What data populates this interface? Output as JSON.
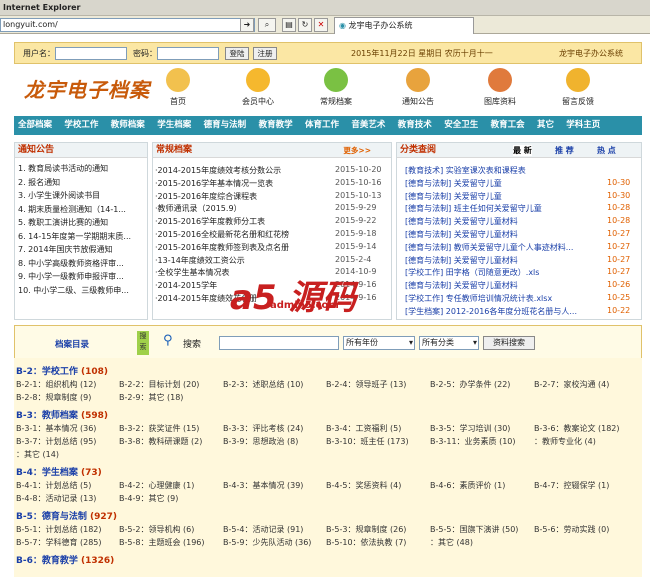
{
  "browser": {
    "title": "Internet Explorer",
    "address": "longyuit.com/",
    "tab": "龙宇电子办公系统"
  },
  "login": {
    "user_label": "用户名：",
    "pass_label": "密码：",
    "login_btn": "登陆",
    "register_btn": "注册",
    "date": "2015年11月22日 星期日 农历十月十一",
    "system": "龙宇电子办公系统"
  },
  "logo": "龙宇电子档案",
  "navicons": [
    {
      "label": "首页",
      "color": "#f2c14e"
    },
    {
      "label": "会员中心",
      "color": "#f5b82e"
    },
    {
      "label": "常规档案",
      "color": "#7ac143"
    },
    {
      "label": "通知公告",
      "color": "#e8a33d"
    },
    {
      "label": "图库资料",
      "color": "#e07a3c"
    },
    {
      "label": "留言反馈",
      "color": "#f0b32e"
    }
  ],
  "mainnav": [
    "全部档案",
    "学校工作",
    "教师档案",
    "学生档案",
    "德育与法制",
    "教育教学",
    "体育工作",
    "音美艺术",
    "教育技术",
    "安全卫生",
    "教育工会",
    "其它",
    "学科主页"
  ],
  "notice": {
    "title": "通知公告",
    "items": [
      "1. 教育局读书活动的通知",
      "2. 报名通知",
      "3. 小学生课外阅读书目",
      "4. 期末质量检测通知（14-1...",
      "5. 教职工演讲比赛的通知",
      "6. 14-15年度第一学期期末质...",
      "7. 2014年国庆节放假通知",
      "8. 中小学高级教师资格评审...",
      "9. 中小学一级教师申报评审...",
      "10. 中小学二级、三级教师申..."
    ]
  },
  "regular": {
    "title": "常规档案",
    "more": "更多>>",
    "items": [
      {
        "t": "·2014-2015年度绩效考核分数公示",
        "d": "2015-10-20"
      },
      {
        "t": "·2015-2016学年基本情况一览表",
        "d": "2015-10-16"
      },
      {
        "t": "·2015-2016年度综合课程表",
        "d": "2015-10-13"
      },
      {
        "t": "·教师通讯录（2015.9）",
        "d": "2015-9-29"
      },
      {
        "t": "·2015-2016学年度教师分工表",
        "d": "2015-9-22"
      },
      {
        "t": "·2015-2016全校最新花名册和红花榜",
        "d": "2015-9-18"
      },
      {
        "t": "·2015-2016年度教师签到表及点名册",
        "d": "2015-9-14"
      },
      {
        "t": "·13-14年度绩效工资公示",
        "d": "2015-2-4"
      },
      {
        "t": "·全校学生基本情况表",
        "d": "2014-10-9"
      },
      {
        "t": "·2014-2015学年",
        "d": "2014-9-16"
      },
      {
        "t": "·2014-2015年度绩效花名册",
        "d": "2014-9-16"
      }
    ]
  },
  "query": {
    "title": "分类查阅",
    "tabs": [
      "最 新",
      "推 荐",
      "热 点"
    ],
    "items": [
      {
        "t": "[教育技术] 实验室课次表和课程表",
        "d": ""
      },
      {
        "t": "[德育与法制] 关爱留守儿童",
        "d": "10-30"
      },
      {
        "t": "[德育与法制] 关爱留守儿童",
        "d": "10-30"
      },
      {
        "t": "[德育与法制] 班主任如何关爱留守儿童",
        "d": "10-28"
      },
      {
        "t": "[德育与法制] 关爱留守儿童材料",
        "d": "10-28"
      },
      {
        "t": "[德育与法制] 关爱留守儿童材料",
        "d": "10-27"
      },
      {
        "t": "[德育与法制] 教师关爱留守儿童个人事迹材料...",
        "d": "10-27"
      },
      {
        "t": "[德育与法制] 关爱留守儿童材料",
        "d": "10-27"
      },
      {
        "t": "[学校工作] 田字格（司随意更改）.xls",
        "d": "10-27"
      },
      {
        "t": "[德育与法制] 关爱留守儿童材料",
        "d": "10-26"
      },
      {
        "t": "[学校工作] 专任教师培训情况统计表.xlsx",
        "d": "10-25"
      },
      {
        "t": "[学生档案] 2012-2016各年度分班花名册与人...",
        "d": "10-22"
      }
    ]
  },
  "archive": {
    "title": "档案目录",
    "side": "搜索",
    "search": "搜索",
    "year": "所有年份",
    "cat": "所有分类",
    "btn": "资料搜索"
  },
  "cats": [
    {
      "h": "B-2：学校工作",
      "c": "(108)",
      "items": [
        "B-2-1：组织机构 (12)",
        "B-2-2：目标计划 (20)",
        "B-2-3：述职总结 (10)",
        "B-2-4：领导班子 (13)",
        "B-2-5：办学条件 (22)",
        "B-2-7：家校沟通 (4)",
        "B-2-8：规章制度 (9)",
        "B-2-9：其它 (18)"
      ]
    },
    {
      "h": "B-3：教师档案",
      "c": "(598)",
      "items": [
        "B-3-1：基本情况 (36)",
        "B-3-2：获奖证件 (15)",
        "B-3-3：评比考核 (24)",
        "B-3-4：工资福利 (5)",
        "B-3-5：学习培训 (30)",
        "B-3-6：教案论文 (182)",
        "B-3-7：计划总结 (95)",
        "B-3-8：教科研课题 (2)",
        "B-3-9：思想政治 (8)",
        "B-3-10：班主任 (173)",
        "B-3-11：业务素质 (10)",
        "：教师专业化 (4)",
        "：其它 (14)"
      ]
    },
    {
      "h": "B-4：学生档案",
      "c": "(73)",
      "items": [
        "B-4-1：计划总结 (5)",
        "B-4-2：心理健康 (1)",
        "B-4-3：基本情况 (39)",
        "B-4-5：奖惩资料 (4)",
        "B-4-6：素质评价 (1)",
        "B-4-7：控辍保学 (1)",
        "B-4-8：活动记录 (13)",
        "B-4-9：其它 (9)"
      ]
    },
    {
      "h": "B-5：德育与法制",
      "c": "(927)",
      "items": [
        "B-5-1：计划总结 (182)",
        "B-5-2：领导机构 (6)",
        "B-5-4：活动记录 (91)",
        "B-5-3：规章制度 (26)",
        "B-5-5：国旗下演讲 (50)",
        "B-5-6：劳动实践 (0)",
        "B-5-7：学科德育 (285)",
        "B-5-8：主题班会 (196)",
        "B-5-9：少先队活动 (36)",
        "B-5-10：依法执教 (7)",
        "：其它 (48)"
      ]
    },
    {
      "h": "B-6：教育教学",
      "c": "(1326)",
      "items": []
    }
  ]
}
